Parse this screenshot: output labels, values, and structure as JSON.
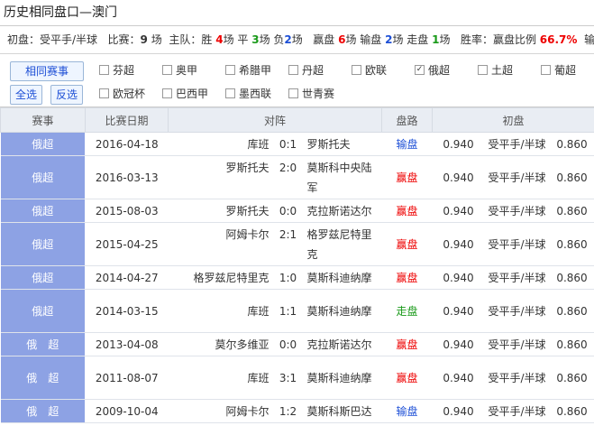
{
  "title": "历史相同盘口—澳门",
  "summary": {
    "label": "初盘：受平手/半球",
    "games_label": "比赛：",
    "games": "9",
    "games_unit": "场",
    "home_label": "主队：胜",
    "home_win": "4",
    "win_unit": "场 平",
    "home_draw": "3",
    "draw_unit": "场 负",
    "home_lose": "2",
    "lose_unit": "场",
    "pan_win_label": "赢盘",
    "pan_win": "6",
    "pan_win_unit": "场 输盘",
    "pan_lose": "2",
    "pan_lose_unit": "场 走盘",
    "pan_draw": "1",
    "pan_draw_unit": "场",
    "ratio_label": "胜率：赢盘比例",
    "ratio": "66.7%",
    "overflow_char": "输"
  },
  "filter": {
    "buttons": {
      "same_league": "相同赛事",
      "select_all": "全选",
      "invert": "反选"
    },
    "leagues": [
      {
        "label": "芬超",
        "checked": false
      },
      {
        "label": "奥甲",
        "checked": false
      },
      {
        "label": "希腊甲",
        "checked": false
      },
      {
        "label": "丹超",
        "checked": false
      },
      {
        "label": "欧联",
        "checked": false
      },
      {
        "label": "俄超",
        "checked": true
      },
      {
        "label": "土超",
        "checked": false
      },
      {
        "label": "葡超",
        "checked": false
      },
      {
        "label": "欧冠杯",
        "checked": false
      },
      {
        "label": "巴西甲",
        "checked": false
      },
      {
        "label": "墨西联",
        "checked": false
      },
      {
        "label": "世青赛",
        "checked": false
      }
    ],
    "check_mark": "✓"
  },
  "table": {
    "headers": [
      "赛事",
      "比赛日期",
      "对阵",
      "盘路",
      "初盘"
    ],
    "rows": [
      {
        "league": "俄超",
        "date": "2016-04-18",
        "home": "库班",
        "score": "0:1",
        "away": "罗斯托夫",
        "result": "输盘",
        "rtype": "lose",
        "h": "0.940",
        "line": "受平手/半球",
        "a": "0.860"
      },
      {
        "league": "俄超",
        "date": "2016-03-13",
        "home": "罗斯托夫",
        "score": "2:0",
        "away": "莫斯科中央陆军",
        "result": "赢盘",
        "rtype": "win",
        "h": "0.940",
        "line": "受平手/半球",
        "a": "0.860"
      },
      {
        "league": "俄超",
        "date": "2015-08-03",
        "home": "罗斯托夫",
        "score": "0:0",
        "away": "克拉斯诺达尔",
        "result": "赢盘",
        "rtype": "win",
        "h": "0.940",
        "line": "受平手/半球",
        "a": "0.860"
      },
      {
        "league": "俄超",
        "date": "2015-04-25",
        "home": "阿姆卡尔",
        "score": "2:1",
        "away": "格罗兹尼特里克",
        "result": "赢盘",
        "rtype": "win",
        "h": "0.940",
        "line": "受平手/半球",
        "a": "0.860"
      },
      {
        "league": "俄超",
        "date": "2014-04-27",
        "home": "格罗兹尼特里克",
        "score": "1:0",
        "away": "莫斯科迪纳摩",
        "result": "赢盘",
        "rtype": "win",
        "h": "0.940",
        "line": "受平手/半球",
        "a": "0.860"
      },
      {
        "league": "俄超",
        "date": "2014-03-15",
        "home": "库班",
        "score": "1:1",
        "away": "莫斯科迪纳摩",
        "result": "走盘",
        "rtype": "draw",
        "h": "0.940",
        "line": "受平手/半球",
        "a": "0.860"
      },
      {
        "league": "俄　超",
        "date": "2013-04-08",
        "home": "莫尔多维亚",
        "score": "0:0",
        "away": "克拉斯诺达尔",
        "result": "赢盘",
        "rtype": "win",
        "h": "0.940",
        "line": "受平手/半球",
        "a": "0.860"
      },
      {
        "league": "俄　超",
        "date": "2011-08-07",
        "home": "库班",
        "score": "3:1",
        "away": "莫斯科迪纳摩",
        "result": "赢盘",
        "rtype": "win",
        "h": "0.940",
        "line": "受平手/半球",
        "a": "0.860"
      },
      {
        "league": "俄　超",
        "date": "2009-10-04",
        "home": "阿姆卡尔",
        "score": "1:2",
        "away": "莫斯科斯巴达",
        "result": "输盘",
        "rtype": "lose",
        "h": "0.940",
        "line": "受平手/半球",
        "a": "0.860"
      }
    ]
  }
}
